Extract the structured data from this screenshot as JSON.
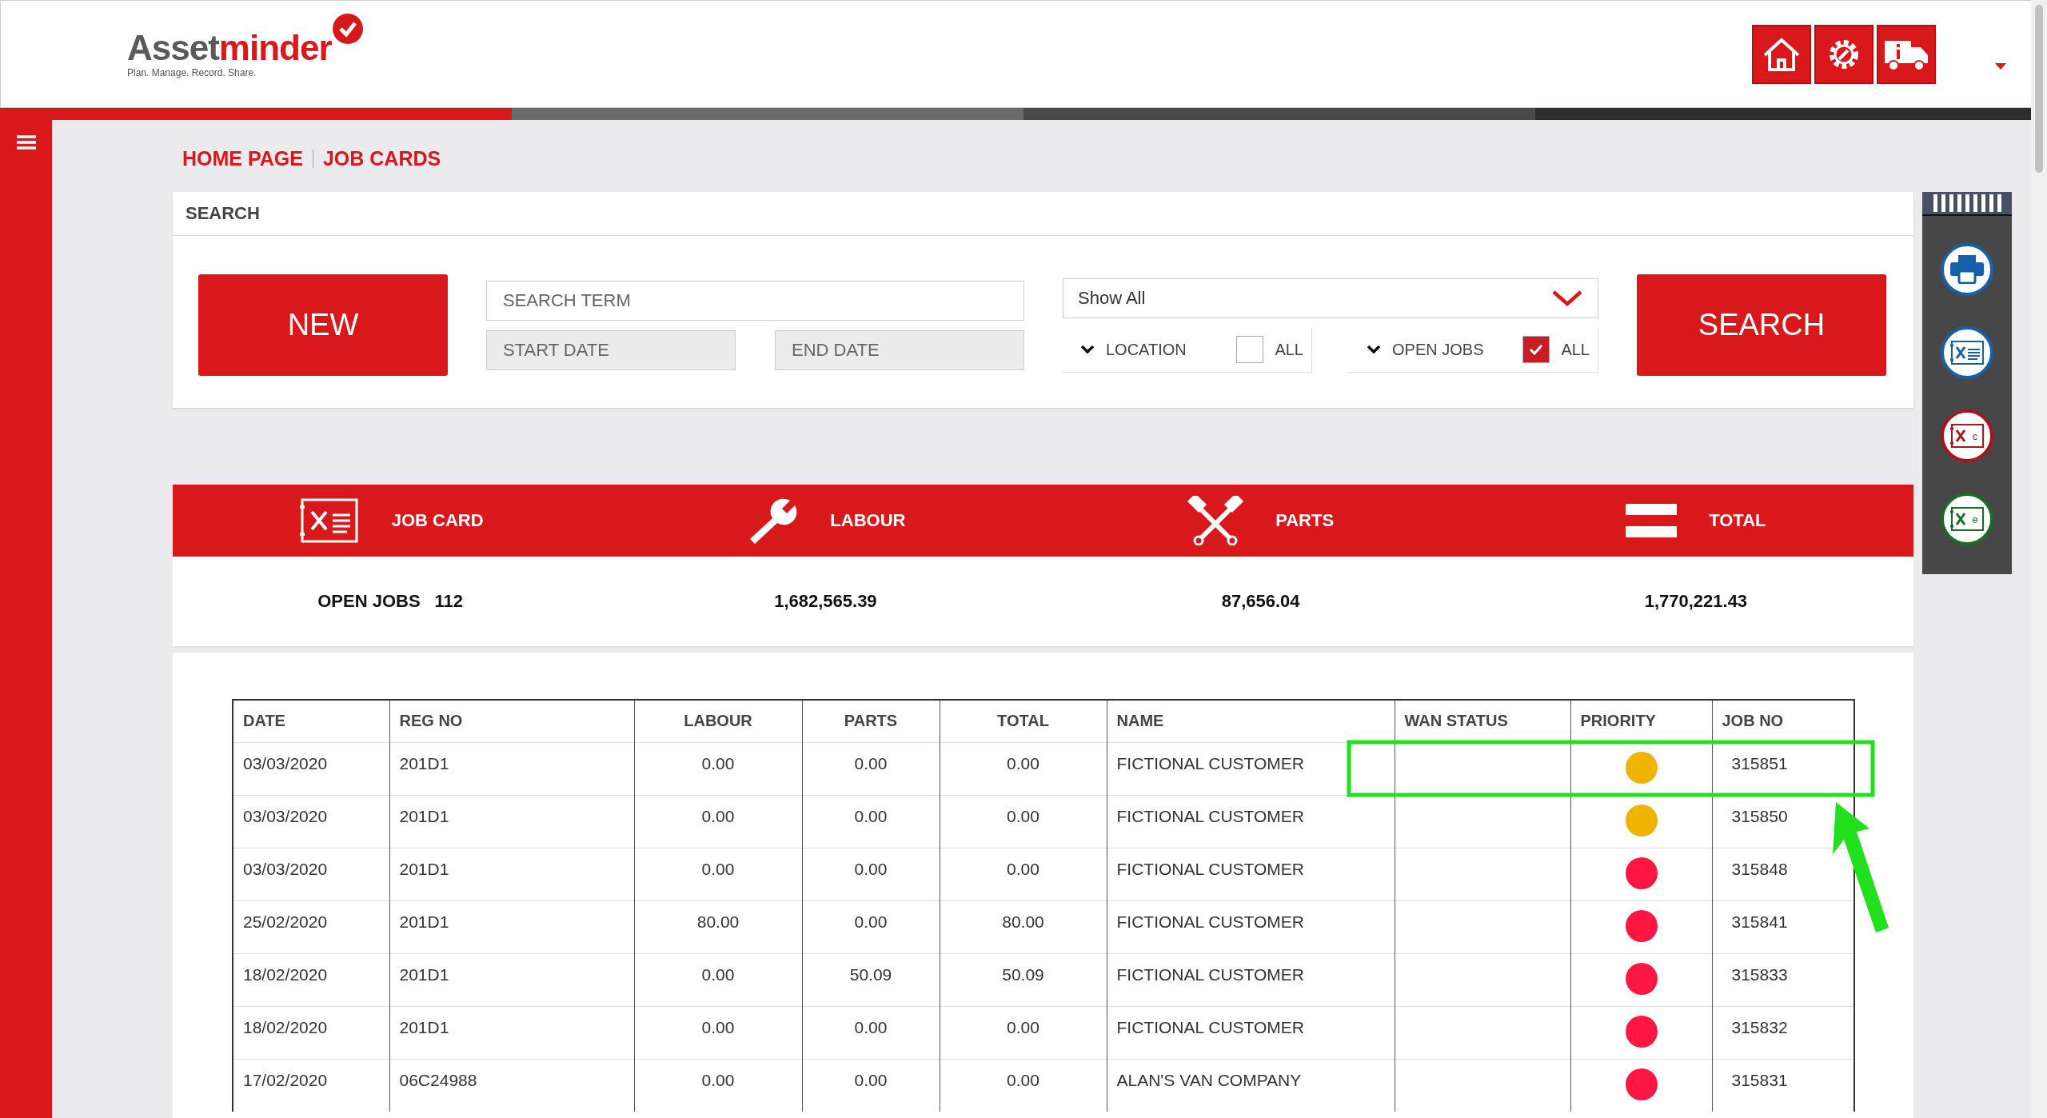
{
  "logo": {
    "brand_first": "Asset",
    "brand_second": "minder",
    "tagline": "Plan. Manage. Record. Share."
  },
  "header_buttons": [
    {
      "kind": "home"
    },
    {
      "kind": "service"
    },
    {
      "kind": "truck"
    }
  ],
  "breadcrumb": [
    {
      "label": "HOME PAGE"
    },
    {
      "label": "JOB CARDS"
    }
  ],
  "search": {
    "title": "SEARCH",
    "new_button": "NEW",
    "search_term": {
      "placeholder": "SEARCH TERM"
    },
    "start_date": {
      "placeholder": "START DATE"
    },
    "end_date": {
      "placeholder": "END DATE"
    },
    "status_select": {
      "value": "Show All"
    },
    "filters": [
      {
        "label": "LOCATION",
        "all_label": "ALL",
        "all_checked": false
      },
      {
        "label": "OPEN JOBS",
        "all_label": "ALL",
        "all_checked": true
      }
    ],
    "search_button": "SEARCH"
  },
  "summary": {
    "columns": [
      {
        "kind": "jobcard",
        "label": "JOB CARD"
      },
      {
        "kind": "wrench",
        "label": "LABOUR"
      },
      {
        "kind": "pistons",
        "label": "PARTS"
      },
      {
        "kind": "equals",
        "label": "TOTAL"
      }
    ],
    "open_jobs_label": "OPEN JOBS",
    "open_jobs_count": "112",
    "labour": "1,682,565.39",
    "parts": "87,656.04",
    "total": "1,770,221.43"
  },
  "side_tools": [
    {
      "kind": "print",
      "color": "#1560a8"
    },
    {
      "kind": "jobcard",
      "color": "#1560a8"
    },
    {
      "kind": "jobcard",
      "letter": "c",
      "color": "#a8161b"
    },
    {
      "kind": "jobcard",
      "letter": "e",
      "color": "#1b6b25"
    }
  ],
  "table": {
    "columns": [
      "DATE",
      "REG NO",
      "LABOUR",
      "PARTS",
      "TOTAL",
      "NAME",
      "WAN STATUS",
      "PRIORITY",
      "JOB NO"
    ],
    "rows": [
      {
        "date": "03/03/2020",
        "reg_no": "201D1",
        "labour": "0.00",
        "parts": "0.00",
        "total": "0.00",
        "name": "FICTIONAL CUSTOMER",
        "color": "#f0b400",
        "job_no": "315851"
      },
      {
        "date": "03/03/2020",
        "reg_no": "201D1",
        "labour": "0.00",
        "parts": "0.00",
        "total": "0.00",
        "name": "FICTIONAL CUSTOMER",
        "color": "#f0b400",
        "job_no": "315850"
      },
      {
        "date": "03/03/2020",
        "reg_no": "201D1",
        "labour": "0.00",
        "parts": "0.00",
        "total": "0.00",
        "name": "FICTIONAL CUSTOMER",
        "color": "#ff1744",
        "job_no": "315848"
      },
      {
        "date": "25/02/2020",
        "reg_no": "201D1",
        "labour": "80.00",
        "parts": "0.00",
        "total": "80.00",
        "name": "FICTIONAL CUSTOMER",
        "color": "#ff1744",
        "job_no": "315841"
      },
      {
        "date": "18/02/2020",
        "reg_no": "201D1",
        "labour": "0.00",
        "parts": "50.09",
        "total": "50.09",
        "name": "FICTIONAL CUSTOMER",
        "color": "#ff1744",
        "job_no": "315833"
      },
      {
        "date": "18/02/2020",
        "reg_no": "201D1",
        "labour": "0.00",
        "parts": "0.00",
        "total": "0.00",
        "name": "FICTIONAL CUSTOMER",
        "color": "#ff1744",
        "job_no": "315832"
      },
      {
        "date": "17/02/2020",
        "reg_no": "06C24988",
        "labour": "0.00",
        "parts": "0.00",
        "total": "0.00",
        "name": "ALAN'S VAN COMPANY",
        "color": "#ff1744",
        "job_no": "315831"
      }
    ]
  }
}
